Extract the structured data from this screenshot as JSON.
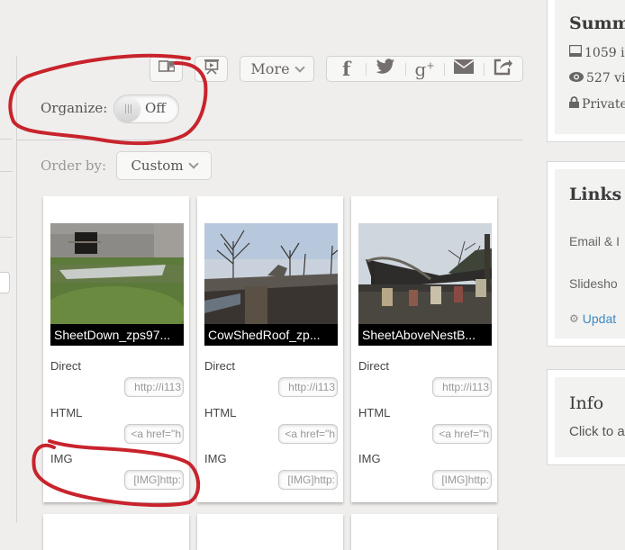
{
  "toolbar": {
    "view_toggle_icon": "split-view-icon",
    "slideshow_icon": "slideshow-icon",
    "more_label": "More",
    "share": [
      {
        "name": "facebook",
        "glyph": "f"
      },
      {
        "name": "twitter",
        "glyph": "🐦"
      },
      {
        "name": "google-plus",
        "glyph": "g⁺"
      },
      {
        "name": "email",
        "glyph": "✉"
      },
      {
        "name": "share",
        "glyph": "↗"
      }
    ]
  },
  "organize": {
    "label": "Organize:",
    "state": "Off"
  },
  "order_by": {
    "label": "Order by:",
    "selected": "Custom"
  },
  "media_cards": [
    {
      "caption": "SheetDown_zps97...",
      "links": [
        {
          "label": "Direct",
          "value": "http://i113"
        },
        {
          "label": "HTML",
          "value": "<a href=\"h"
        },
        {
          "label": "IMG",
          "value": "[IMG]http:"
        }
      ]
    },
    {
      "caption": "CowShedRoof_zp...",
      "links": [
        {
          "label": "Direct",
          "value": "http://i113"
        },
        {
          "label": "HTML",
          "value": "<a href=\"h"
        },
        {
          "label": "IMG",
          "value": "[IMG]http:"
        }
      ]
    },
    {
      "caption": "SheetAboveNestB...",
      "links": [
        {
          "label": "Direct",
          "value": "http://i113"
        },
        {
          "label": "HTML",
          "value": "<a href=\"h"
        },
        {
          "label": "IMG",
          "value": "[IMG]http:"
        }
      ]
    }
  ],
  "sidebar": {
    "summary": {
      "title": "Summ",
      "images": "1059 i",
      "views": "527 vi",
      "privacy": "Private"
    },
    "links": {
      "title": "Links",
      "email": "Email & I",
      "slideshow": "Slidesho",
      "update": "Updat"
    },
    "info": {
      "title": "Info",
      "hint": "Click to a"
    }
  },
  "colors": {
    "annotation_red": "#c8232c",
    "link_blue": "#3e8ac4"
  }
}
